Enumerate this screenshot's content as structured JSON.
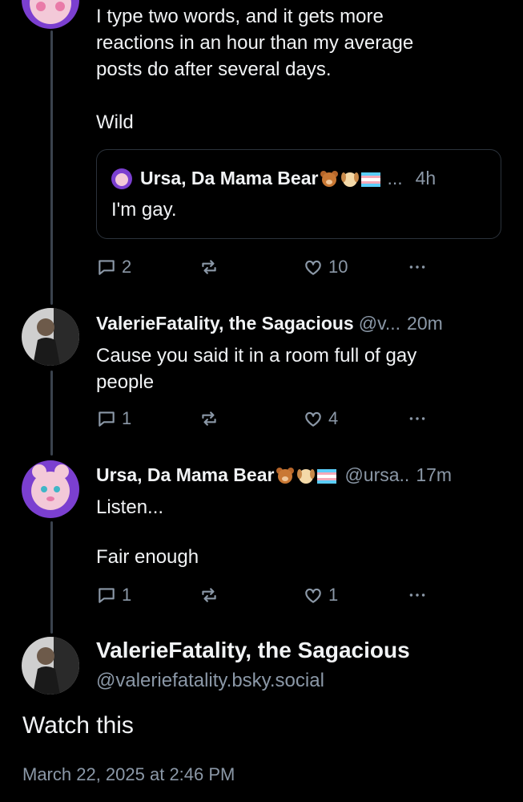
{
  "post0": {
    "text_line1": "I type two words, and it gets more",
    "text_line2": "reactions in an hour than my average",
    "text_line3": "posts do after several days.",
    "text_line4": "Wild",
    "quote": {
      "name": "Ursa, Da Mama Bear",
      "ellipsis": "...",
      "time": "4h",
      "text": "I'm gay."
    },
    "replies": "2",
    "likes": "10"
  },
  "post1": {
    "name": "ValerieFatality, the Sagacious",
    "handle": "@v...",
    "time": "20m",
    "text_line1": "Cause you said it in a room full of gay",
    "text_line2": "people",
    "replies": "1",
    "likes": "4"
  },
  "post2": {
    "name": "Ursa, Da Mama Bear",
    "handle": "@ursa..",
    "time": "17m",
    "text_line1": "Listen...",
    "text_line2": "Fair enough",
    "replies": "1",
    "likes": "1"
  },
  "main_post": {
    "name": "ValerieFatality, the Sagacious",
    "handle": "@valeriefatality.bsky.social",
    "text": "Watch this",
    "date": "March 22, 2025 at 2:46 PM"
  },
  "icons": [
    "reply-icon",
    "repost-icon",
    "like-icon",
    "more-icon",
    "bear-emoji",
    "dog-emoji",
    "trans-flag-emoji"
  ],
  "colors": {
    "background": "#000000",
    "text": "#f1f3f5",
    "muted": "#8b98a7",
    "thread_line": "#3a424d"
  }
}
